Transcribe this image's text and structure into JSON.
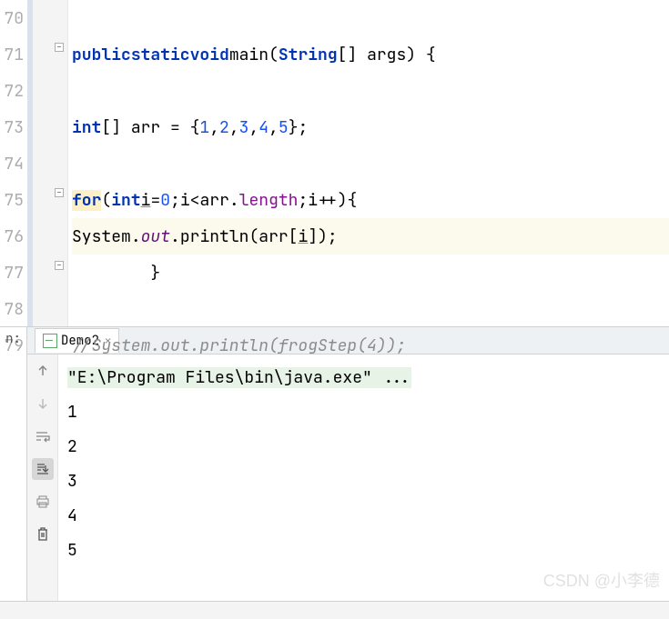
{
  "editor": {
    "lines": {
      "70": "70",
      "71": "71",
      "72": "72",
      "73": "73",
      "74": "74",
      "75": "75",
      "76": "76",
      "77": "77",
      "78": "78",
      "79": "79"
    },
    "code": {
      "l71_public": "public",
      "l71_static": "static",
      "l71_void": "void",
      "l71_main": "main",
      "l71_String": "String",
      "l71_args": "args",
      "l73_int": "int",
      "l73_arr": "arr",
      "l73_vals": "1,2,3,4,5",
      "l73_n1": "1",
      "l73_n2": "2",
      "l73_n3": "3",
      "l73_n4": "4",
      "l73_n5": "5",
      "l75_for": "for",
      "l75_int": "int",
      "l75_i": "i",
      "l75_zero": "0",
      "l75_arr": "arr",
      "l75_length": "length",
      "l76_System": "System",
      "l76_out": "out",
      "l76_println": "println",
      "l76_arr": "arr",
      "l76_i": "i",
      "l79_comment": "//",
      "l79_text": "System.out.println(frogStep(4));"
    }
  },
  "run": {
    "label": "n:",
    "tab_name": "Demo2",
    "command": "\"E:\\Program Files\\bin\\java.exe\" ...",
    "output": [
      "1",
      "2",
      "3",
      "4",
      "5"
    ]
  },
  "watermark": "CSDN @小李德"
}
